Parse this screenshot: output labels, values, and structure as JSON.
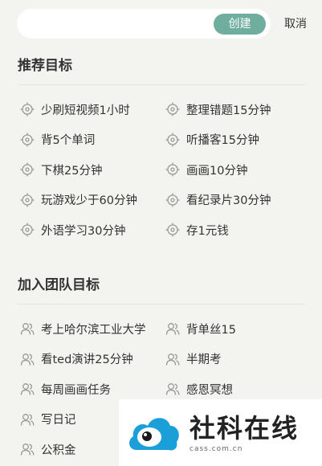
{
  "header": {
    "search_placeholder": "",
    "create_label": "创建",
    "cancel_label": "取消"
  },
  "recommended": {
    "title": "推荐目标",
    "left": [
      "少刷短视频1小时",
      "背5个单词",
      "下棋25分钟",
      "玩游戏少于60分钟",
      "外语学习30分钟"
    ],
    "right": [
      "整理错题15分钟",
      "听播客15分钟",
      "画画10分钟",
      "看纪录片30分钟",
      "存1元钱"
    ],
    "icon": "target-icon"
  },
  "team": {
    "title": "加入团队目标",
    "left": [
      "考上哈尔滨工业大学",
      "看ted演讲25分钟",
      "每周画画任务",
      "写日记",
      "公积金"
    ],
    "right": [
      "背单丝15",
      "半期考",
      "感恩冥想"
    ],
    "icon": "people-icon"
  },
  "watermark": {
    "title": "社科在线",
    "url": "cass.com.cn"
  },
  "colors": {
    "background": "#f3f3ef",
    "accent": "#6fae9f",
    "logo_blue": "#1a9fd9"
  }
}
